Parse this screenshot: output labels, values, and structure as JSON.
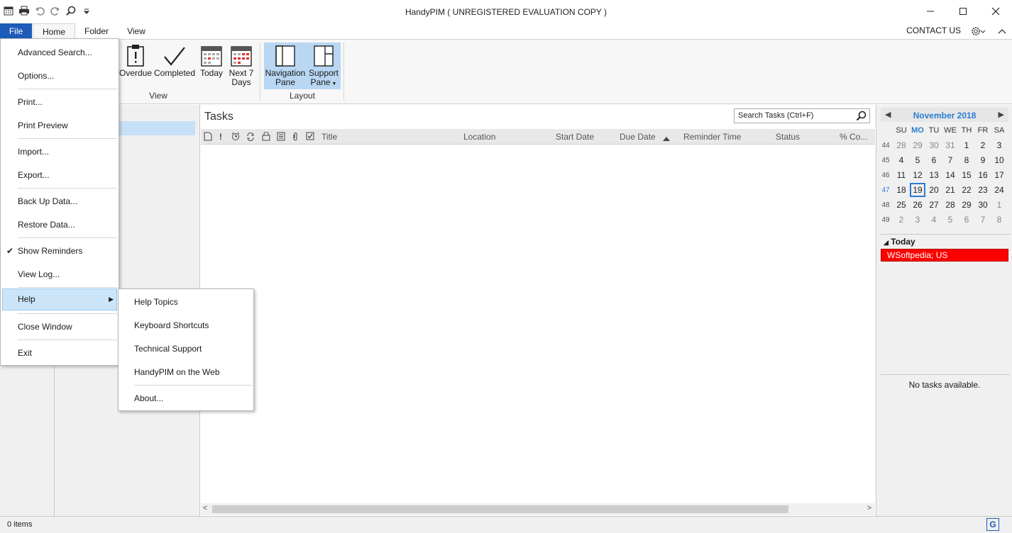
{
  "window": {
    "title": "HandyPIM ( UNREGISTERED EVALUATION COPY )"
  },
  "ribbon": {
    "tabs": [
      "File",
      "Home",
      "Folder",
      "View"
    ],
    "contact_us": "CONTACT US",
    "buttons": {
      "overdue": "Overdue",
      "completed": "Completed",
      "today": "Today",
      "next7_line1": "Next 7",
      "next7_line2": "Days",
      "navpane_line1": "Navigation",
      "navpane_line2": "Pane",
      "support_line1": "Support",
      "support_line2": "Pane"
    },
    "groups": {
      "view": "View",
      "layout": "Layout"
    }
  },
  "file_menu": {
    "items": [
      "Advanced Search...",
      "Options...",
      "Print...",
      "Print Preview",
      "Import...",
      "Export...",
      "Back Up Data...",
      "Restore Data...",
      "Show Reminders",
      "View Log...",
      "Help",
      "Close Window",
      "Exit"
    ],
    "show_reminders_checked": true,
    "highlighted": "Help"
  },
  "help_menu": {
    "items": [
      "Help Topics",
      "Keyboard Shortcuts",
      "Technical Support",
      "HandyPIM on the Web",
      "About..."
    ]
  },
  "tasks": {
    "title": "Tasks",
    "search_placeholder": "Search Tasks (Ctrl+F)",
    "columns": [
      "Title",
      "Location",
      "Start Date",
      "Due Date",
      "Reminder Time",
      "Status",
      "% Co..."
    ],
    "sort_column": "Due Date"
  },
  "calendar": {
    "month": "November 2018",
    "weekdays": [
      "SU",
      "MO",
      "TU",
      "WE",
      "TH",
      "FR",
      "SA"
    ],
    "highlighted_weekday": "MO",
    "week_numbers": [
      "44",
      "45",
      "46",
      "47",
      "48",
      "49"
    ],
    "current_week": "47",
    "weeks": [
      [
        "28",
        "29",
        "30",
        "31",
        "1",
        "2",
        "3"
      ],
      [
        "4",
        "5",
        "6",
        "7",
        "8",
        "9",
        "10"
      ],
      [
        "11",
        "12",
        "13",
        "14",
        "15",
        "16",
        "17"
      ],
      [
        "18",
        "19",
        "20",
        "21",
        "22",
        "23",
        "24"
      ],
      [
        "25",
        "26",
        "27",
        "28",
        "29",
        "30",
        "1"
      ],
      [
        "2",
        "3",
        "4",
        "5",
        "6",
        "7",
        "8"
      ]
    ],
    "selected_day": "19"
  },
  "today_section": {
    "header": "Today",
    "appointment": "WSoftpedia; US",
    "appointment_color": "#ff0000"
  },
  "task_panel": {
    "empty_text": "No tasks available."
  },
  "status_bar": {
    "items_count": "0 items"
  },
  "colors": {
    "accent": "#1d5cb8",
    "calendar_accent": "#2a7dd1",
    "selection": "#b9d7f3"
  }
}
